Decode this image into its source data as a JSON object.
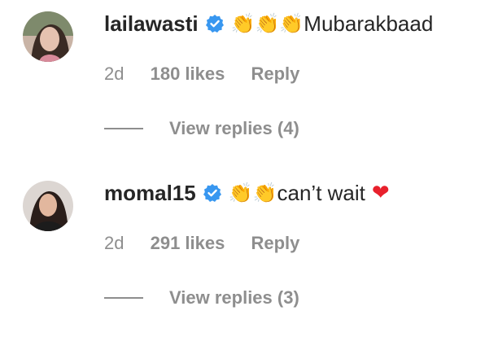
{
  "comments": [
    {
      "avatar": "user-avatar-photo",
      "username": "lailawasti",
      "verified": true,
      "emoji": "👏👏👏",
      "text": "Mubarakbaad",
      "heart": "",
      "time": "2d",
      "likes": "180 likes",
      "reply_label": "Reply",
      "view_replies": "View replies (4)"
    },
    {
      "avatar": "user-avatar-photo",
      "username": "momal15",
      "verified": true,
      "emoji": "👏👏",
      "text": " can’t wait",
      "heart": "❤",
      "time": "2d",
      "likes": "291 likes",
      "reply_label": "Reply",
      "view_replies": "View replies (3)"
    }
  ],
  "colors": {
    "text": "#262626",
    "muted": "#8e8e8e",
    "verified_badge": "#3897f0",
    "heart": "#e8202c"
  }
}
